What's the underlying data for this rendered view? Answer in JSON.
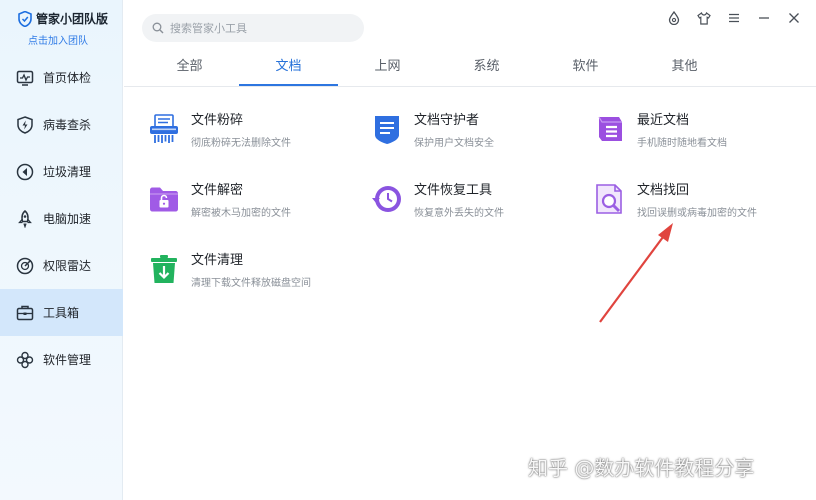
{
  "brand": {
    "title": "管家小团队版",
    "link": "点击加入团队"
  },
  "sidebar": {
    "items": [
      {
        "label": "首页体检",
        "icon": "monitor-check-icon"
      },
      {
        "label": "病毒查杀",
        "icon": "shield-bolt-icon"
      },
      {
        "label": "垃圾清理",
        "icon": "clean-arrow-icon"
      },
      {
        "label": "电脑加速",
        "icon": "rocket-icon"
      },
      {
        "label": "权限雷达",
        "icon": "radar-icon"
      },
      {
        "label": "工具箱",
        "icon": "toolbox-icon",
        "active": true
      },
      {
        "label": "软件管理",
        "icon": "apps-icon"
      }
    ]
  },
  "search": {
    "placeholder": "搜索管家小工具"
  },
  "window_controls": [
    "skin-droplet-icon",
    "shirt-icon",
    "menu-icon",
    "minimize-icon",
    "close-icon"
  ],
  "tabs": [
    {
      "label": "全部"
    },
    {
      "label": "文档",
      "active": true
    },
    {
      "label": "上网"
    },
    {
      "label": "系统"
    },
    {
      "label": "软件"
    },
    {
      "label": "其他"
    }
  ],
  "tools": [
    {
      "title": "文件粉碎",
      "desc": "彻底粉碎无法删除文件",
      "icon": "shredder-icon",
      "color": "#2f6fe0"
    },
    {
      "title": "文档守护者",
      "desc": "保护用户文档安全",
      "icon": "document-shield-icon",
      "color": "#2f6fe0"
    },
    {
      "title": "最近文档",
      "desc": "手机随时随地看文档",
      "icon": "recent-docs-icon",
      "color": "#9b4fe0"
    },
    {
      "title": "文件解密",
      "desc": "解密被木马加密的文件",
      "icon": "folder-lock-icon",
      "color": "#a05be6"
    },
    {
      "title": "文件恢复工具",
      "desc": "恢复意外丢失的文件",
      "icon": "restore-clock-icon",
      "color": "#8a54e0"
    },
    {
      "title": "文档找回",
      "desc": "找回误删或病毒加密的文件",
      "icon": "doc-search-icon",
      "color": "#9b5fe3"
    },
    {
      "title": "文件清理",
      "desc": "清理下载文件释放磁盘空间",
      "icon": "trash-download-icon",
      "color": "#22b35e"
    }
  ],
  "watermark": "知乎 @数办软件教程分享",
  "colors": {
    "accent": "#2d76e0",
    "sidebar_active": "#d3e7fb",
    "annotation_arrow": "#e0443e"
  }
}
